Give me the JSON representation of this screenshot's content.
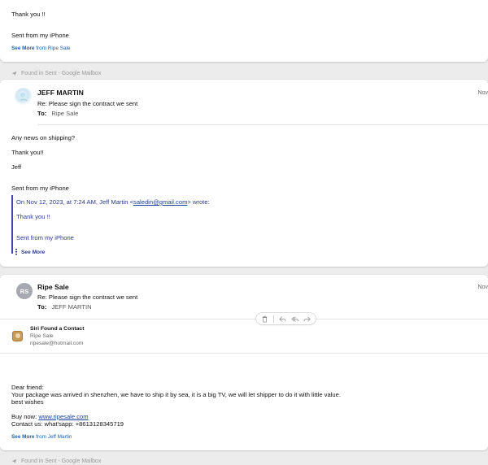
{
  "card1": {
    "thanks": "Thank you !!",
    "sent_from": "Sent from my iPhone",
    "see_more_label": "See More",
    "see_more_from": "from Ripe Sale"
  },
  "found_in_sent": "Found in Sent - Google Mailbox",
  "card2": {
    "sender": "JEFF MARTIN",
    "subject": "Re: Please sign the contract we sent",
    "to_label": "To:",
    "to_value": "Ripe Sale",
    "date": "Nov",
    "body": {
      "line1": "Any news on shipping?",
      "line2": "Thank you!!",
      "line3": "Jeff",
      "line4": "Sent from my iPhone"
    },
    "quote": {
      "header_prefix": "On Nov 12, 2023, at 7:24 AM, Jeff Martin <",
      "header_email": "saledin@gmail.com",
      "header_suffix": "> wrote:",
      "thanks": "Thank you !!",
      "sent_from": "Sent from my iPhone"
    },
    "see_more": "See More"
  },
  "card3": {
    "avatar_initials": "RS",
    "sender": "Ripe Sale",
    "subject": "Re: Please sign the contract we sent",
    "to_label": "To:",
    "to_value": "JEFF MARTIN",
    "date": "Nov",
    "siri": {
      "title": "Siri Found a Contact",
      "name": "Ripe Sale",
      "email": "ripesale@hotmail.com"
    },
    "body": {
      "greeting": "Dear friend:",
      "line1": "Your package was arrived in shenzhen, we have to ship it by sea, it is  a big TV, we will let shipper to do it with little value.",
      "line2": "best wishes",
      "buy_label": "Buy now: ",
      "buy_link": "www.ripesale.com",
      "contact": "Contact us: what'sapp: +8613128345719"
    },
    "see_more_label": "See More",
    "see_more_from": "from Jeff Martin"
  },
  "toolbar_icons": [
    "trash-icon",
    "reply-icon",
    "reply-all-icon",
    "forward-icon"
  ],
  "colors": {
    "link_blue": "#1a5fb4",
    "quote_blue": "#2a3a8c",
    "background": "#ececec"
  }
}
